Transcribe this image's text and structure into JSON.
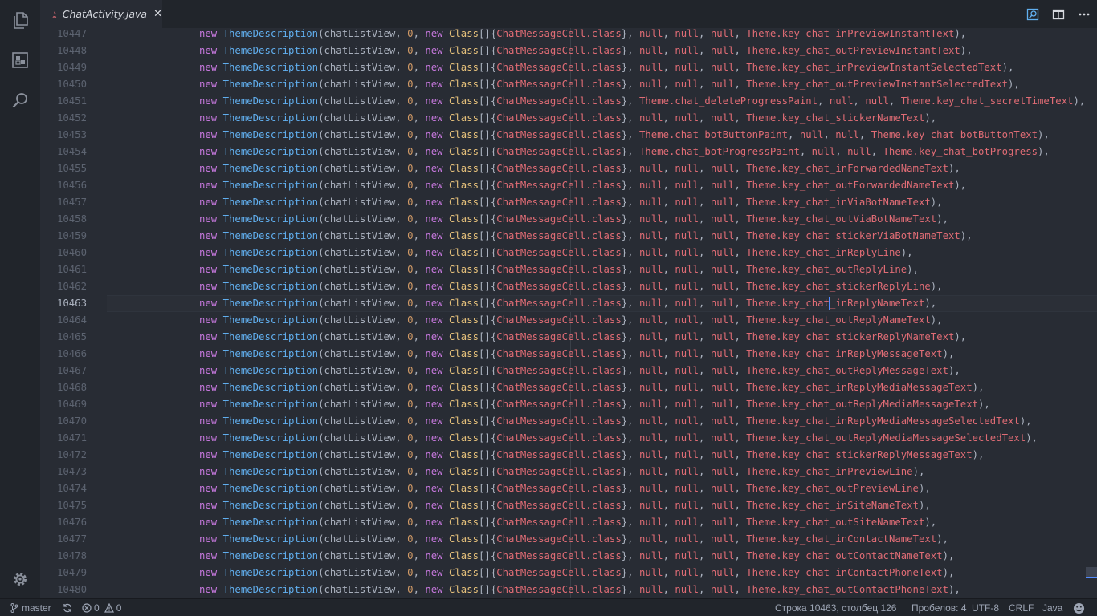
{
  "tab": {
    "title": "ChatActivity.java",
    "close_glyph": "✕",
    "icon": "java-icon"
  },
  "activity_bar": {
    "items": [
      "files-icon",
      "extensions-icon",
      "search-icon"
    ],
    "bottom": "gear-icon"
  },
  "tab_actions": [
    "open-changes-icon",
    "split-editor-icon",
    "more-actions-icon"
  ],
  "editor": {
    "current_line": 10463,
    "lines": [
      {
        "n": "10447",
        "first": "null",
        "second": "null",
        "key": "Theme.key_chat_inPreviewInstantText"
      },
      {
        "n": "10448",
        "first": "null",
        "second": "null",
        "key": "Theme.key_chat_outPreviewInstantText"
      },
      {
        "n": "10449",
        "first": "null",
        "second": "null",
        "key": "Theme.key_chat_inPreviewInstantSelectedText"
      },
      {
        "n": "10450",
        "first": "null",
        "second": "null",
        "key": "Theme.key_chat_outPreviewInstantSelectedText"
      },
      {
        "n": "10451",
        "first": "Theme.chat_deleteProgressPaint",
        "second": "null",
        "key": "Theme.key_chat_secretTimeText"
      },
      {
        "n": "10452",
        "first": "null",
        "second": "null",
        "key": "Theme.key_chat_stickerNameText"
      },
      {
        "n": "10453",
        "first": "Theme.chat_botButtonPaint",
        "second": "null",
        "key": "Theme.key_chat_botButtonText"
      },
      {
        "n": "10454",
        "first": "Theme.chat_botProgressPaint",
        "second": "null",
        "key": "Theme.key_chat_botProgress"
      },
      {
        "n": "10455",
        "first": "null",
        "second": "null",
        "key": "Theme.key_chat_inForwardedNameText"
      },
      {
        "n": "10456",
        "first": "null",
        "second": "null",
        "key": "Theme.key_chat_outForwardedNameText"
      },
      {
        "n": "10457",
        "first": "null",
        "second": "null",
        "key": "Theme.key_chat_inViaBotNameText"
      },
      {
        "n": "10458",
        "first": "null",
        "second": "null",
        "key": "Theme.key_chat_outViaBotNameText"
      },
      {
        "n": "10459",
        "first": "null",
        "second": "null",
        "key": "Theme.key_chat_stickerViaBotNameText"
      },
      {
        "n": "10460",
        "first": "null",
        "second": "null",
        "key": "Theme.key_chat_inReplyLine"
      },
      {
        "n": "10461",
        "first": "null",
        "second": "null",
        "key": "Theme.key_chat_outReplyLine"
      },
      {
        "n": "10462",
        "first": "null",
        "second": "null",
        "key": "Theme.key_chat_stickerReplyLine"
      },
      {
        "n": "10463",
        "first": "null",
        "second": "null",
        "key": "Theme.key_chat_inReplyNameText"
      },
      {
        "n": "10464",
        "first": "null",
        "second": "null",
        "key": "Theme.key_chat_outReplyNameText"
      },
      {
        "n": "10465",
        "first": "null",
        "second": "null",
        "key": "Theme.key_chat_stickerReplyNameText"
      },
      {
        "n": "10466",
        "first": "null",
        "second": "null",
        "key": "Theme.key_chat_inReplyMessageText"
      },
      {
        "n": "10467",
        "first": "null",
        "second": "null",
        "key": "Theme.key_chat_outReplyMessageText"
      },
      {
        "n": "10468",
        "first": "null",
        "second": "null",
        "key": "Theme.key_chat_inReplyMediaMessageText"
      },
      {
        "n": "10469",
        "first": "null",
        "second": "null",
        "key": "Theme.key_chat_outReplyMediaMessageText"
      },
      {
        "n": "10470",
        "first": "null",
        "second": "null",
        "key": "Theme.key_chat_inReplyMediaMessageSelectedText"
      },
      {
        "n": "10471",
        "first": "null",
        "second": "null",
        "key": "Theme.key_chat_outReplyMediaMessageSelectedText"
      },
      {
        "n": "10472",
        "first": "null",
        "second": "null",
        "key": "Theme.key_chat_stickerReplyMessageText"
      },
      {
        "n": "10473",
        "first": "null",
        "second": "null",
        "key": "Theme.key_chat_inPreviewLine"
      },
      {
        "n": "10474",
        "first": "null",
        "second": "null",
        "key": "Theme.key_chat_outPreviewLine"
      },
      {
        "n": "10475",
        "first": "null",
        "second": "null",
        "key": "Theme.key_chat_inSiteNameText"
      },
      {
        "n": "10476",
        "first": "null",
        "second": "null",
        "key": "Theme.key_chat_outSiteNameText"
      },
      {
        "n": "10477",
        "first": "null",
        "second": "null",
        "key": "Theme.key_chat_inContactNameText"
      },
      {
        "n": "10478",
        "first": "null",
        "second": "null",
        "key": "Theme.key_chat_outContactNameText"
      },
      {
        "n": "10479",
        "first": "null",
        "second": "null",
        "key": "Theme.key_chat_inContactPhoneText"
      },
      {
        "n": "10480",
        "first": "null",
        "second": "null",
        "key": "Theme.key_chat_outContactPhoneText"
      }
    ]
  },
  "status_bar": {
    "branch": "master",
    "errors": "0",
    "warnings": "0",
    "position": "Строка 10463, столбец 126",
    "indent": "Пробелов: 4",
    "encoding": "UTF-8",
    "eol": "CRLF",
    "language": "Java",
    "feedback_icon": "smiley-icon"
  },
  "colors": {
    "keyword": "#c678dd",
    "type": "#61afef",
    "class": "#e5c07b",
    "number": "#d19a66",
    "field": "#e06c75",
    "background": "#282c34",
    "chrome": "#21252b"
  }
}
